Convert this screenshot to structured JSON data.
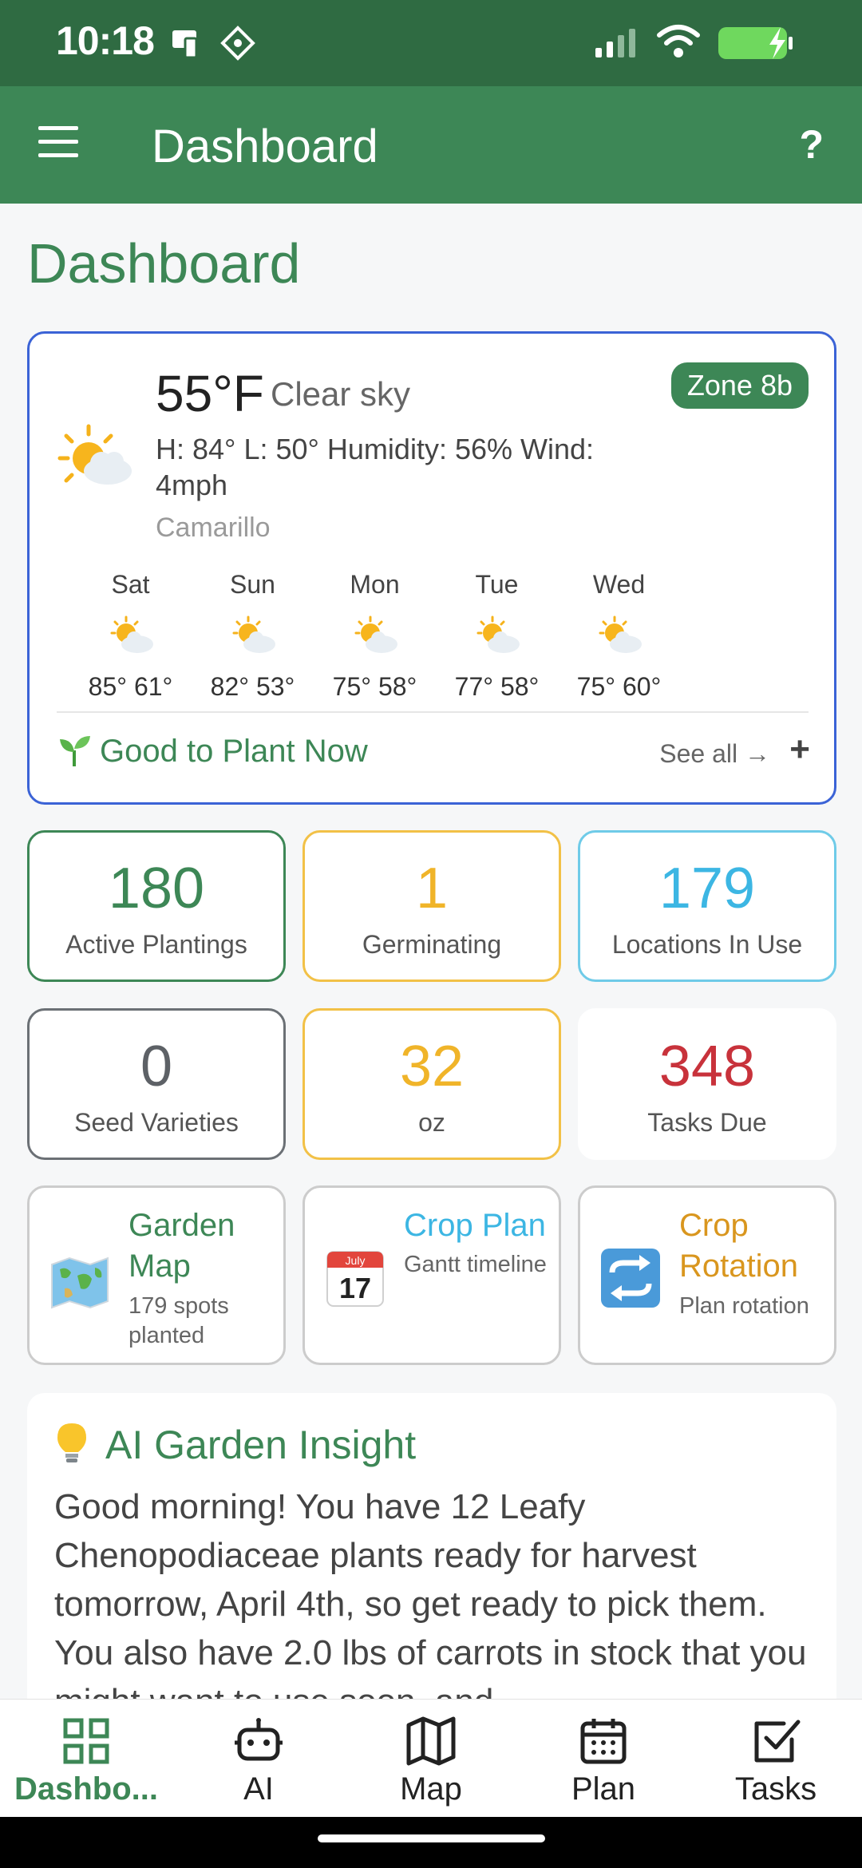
{
  "status_bar": {
    "time": "10:18"
  },
  "app_bar": {
    "title": "Dashboard",
    "help_label": "?"
  },
  "page": {
    "title": "Dashboard"
  },
  "weather": {
    "temperature": "55°F",
    "condition": "Clear sky",
    "zone": "Zone 8b",
    "details": "H: 84°  L: 50°  Humidity: 56%  Wind: 4mph",
    "location": "Camarillo",
    "forecast": [
      {
        "day": "Sat",
        "temps": "85° 61°"
      },
      {
        "day": "Sun",
        "temps": "82° 53°"
      },
      {
        "day": "Mon",
        "temps": "75° 58°"
      },
      {
        "day": "Tue",
        "temps": "77° 58°"
      },
      {
        "day": "Wed",
        "temps": "75° 60°"
      }
    ],
    "plant_now_label": "Good to Plant Now",
    "see_all_label": "See all →",
    "add_label": "+"
  },
  "stats": [
    {
      "value": "180",
      "label": "Active Plantings",
      "color": "#3d8756"
    },
    {
      "value": "1",
      "label": "Germinating",
      "color": "#f0b429"
    },
    {
      "value": "179",
      "label": "Locations In Use",
      "color": "#3cb6e3"
    },
    {
      "value": "0",
      "label": "Seed Varieties",
      "color": "#5d6166"
    },
    {
      "value": "32",
      "label": "oz",
      "color": "#f0b429"
    },
    {
      "value": "348",
      "label": "Tasks Due",
      "color": "#c8323b"
    }
  ],
  "nav_cards": [
    {
      "title": "Garden Map",
      "subtitle": "179 spots planted",
      "icon": "world-map-icon",
      "color": "#3d8756"
    },
    {
      "title": "Crop Plan",
      "subtitle": "Gantt timeline",
      "icon": "calendar-icon",
      "calendar_month": "July",
      "calendar_day": "17",
      "color": "#3cb6e3"
    },
    {
      "title": "Crop Rotation",
      "subtitle": "Plan rotation",
      "icon": "rotate-arrows-icon",
      "color": "#d9961e"
    }
  ],
  "insight": {
    "title": "AI Garden Insight",
    "text": "Good morning! You have 12 Leafy Chenopodiaceae plants ready for harvest tomorrow, April 4th, so get ready to pick them. You also have 2.0 lbs of carrots in stock that you might want to use soon, and"
  },
  "bottom_nav": [
    {
      "label": "Dashbo...",
      "icon": "grid-icon",
      "active": true
    },
    {
      "label": "AI",
      "icon": "robot-icon",
      "active": false
    },
    {
      "label": "Map",
      "icon": "map-icon",
      "active": false
    },
    {
      "label": "Plan",
      "icon": "calendar-icon",
      "active": false
    },
    {
      "label": "Tasks",
      "icon": "checkbox-icon",
      "active": false
    }
  ]
}
